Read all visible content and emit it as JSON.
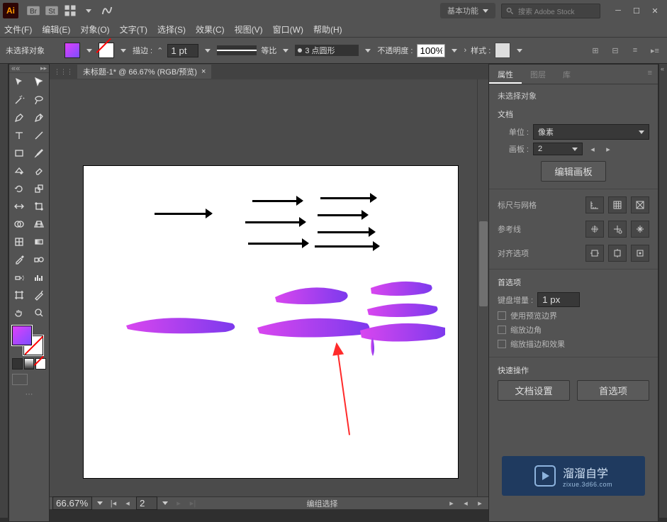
{
  "titlebar": {
    "workspace": "基本功能",
    "search_placeholder": "搜索 Adobe Stock"
  },
  "menus": [
    "文件(F)",
    "编辑(E)",
    "对象(O)",
    "文字(T)",
    "选择(S)",
    "效果(C)",
    "视图(V)",
    "窗口(W)",
    "帮助(H)"
  ],
  "control": {
    "no_selection": "未选择对象",
    "stroke_label": "描边 :",
    "stroke_weight": "1 pt",
    "uniform_label": "等比",
    "brush_label": "3 点圆形",
    "opacity_label": "不透明度 :",
    "opacity_value": "100%",
    "style_label": "样式 :"
  },
  "doc_tab": "未标题-1* @ 66.67% (RGB/预览)",
  "status": {
    "zoom": "66.67%",
    "page": "2",
    "mode": "编组选择"
  },
  "props": {
    "tabs": [
      "属性",
      "图层",
      "库"
    ],
    "no_selection": "未选择对象",
    "doc_section": "文档",
    "unit_label": "单位 :",
    "unit_value": "像素",
    "artboard_label": "画板 :",
    "artboard_value": "2",
    "edit_artboards": "编辑画板",
    "ruler_grid": "标尺与网格",
    "guides": "参考线",
    "align": "对齐选项",
    "prefs_section": "首选项",
    "key_inc_label": "键盘增量 :",
    "key_inc_value": "1 px",
    "preview_bounds": "使用预览边界",
    "scale_corners": "缩放边角",
    "scale_strokes": "缩放描边和效果",
    "quick_actions": "快速操作",
    "doc_setup": "文档设置",
    "pref_btn": "首选项"
  },
  "watermark": {
    "name": "溜溜自学",
    "url": "zixue.3d66.com"
  }
}
